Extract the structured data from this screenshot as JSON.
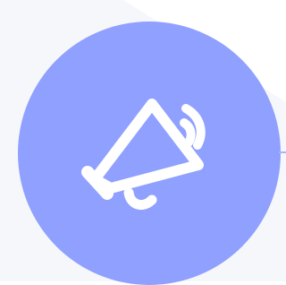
{
  "colors": {
    "page_background": "#ffffff",
    "panel_background": "#f6f7fa",
    "circle_fill": "#8fa0ff",
    "icon_stroke": "#ffffff",
    "edge_accent": "#a9b4ff"
  },
  "icon": {
    "name": "megaphone-icon",
    "style": "outline"
  }
}
